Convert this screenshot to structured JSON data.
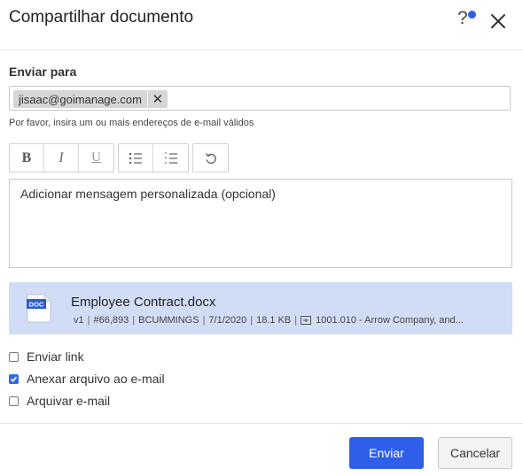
{
  "dialog": {
    "title": "Compartilhar documento"
  },
  "header_icons": {
    "help": "?",
    "help_icon": "question-mark-icon",
    "close_icon": "close-icon"
  },
  "recipients": {
    "label": "Enviar para",
    "chips": [
      {
        "email": "jisaac@goimanage.com",
        "remove": "✕"
      }
    ],
    "hint": "Por favor, insira um ou mais endereços de e-mail válidos"
  },
  "toolbar": {
    "bold": "B",
    "italic": "I",
    "underline": "U",
    "icons": [
      "bold-icon",
      "italic-icon",
      "underline-icon",
      "bulleted-list-icon",
      "numbered-list-icon",
      "undo-icon"
    ]
  },
  "message": {
    "placeholder": "Adicionar mensagem personalizada (opcional)"
  },
  "file": {
    "badge": "DOC",
    "name": "Employee Contract.docx",
    "version": "v1",
    "number": "#66,893",
    "author": "BCUMMINGS",
    "date": "7/1/2020",
    "size": "18.1 KB",
    "location": "1001.010 - Arrow Company, and..."
  },
  "options": [
    {
      "label": "Enviar link",
      "checked": false
    },
    {
      "label": "Anexar arquivo ao e-mail",
      "checked": true
    },
    {
      "label": "Arquivar e-mail",
      "checked": false
    }
  ],
  "buttons": {
    "send": "Enviar",
    "cancel": "Cancelar"
  },
  "colors": {
    "primary": "#2f5fe8",
    "file_bg": "#d1ddf6",
    "checkbox_checked": "#2f6ae0"
  }
}
